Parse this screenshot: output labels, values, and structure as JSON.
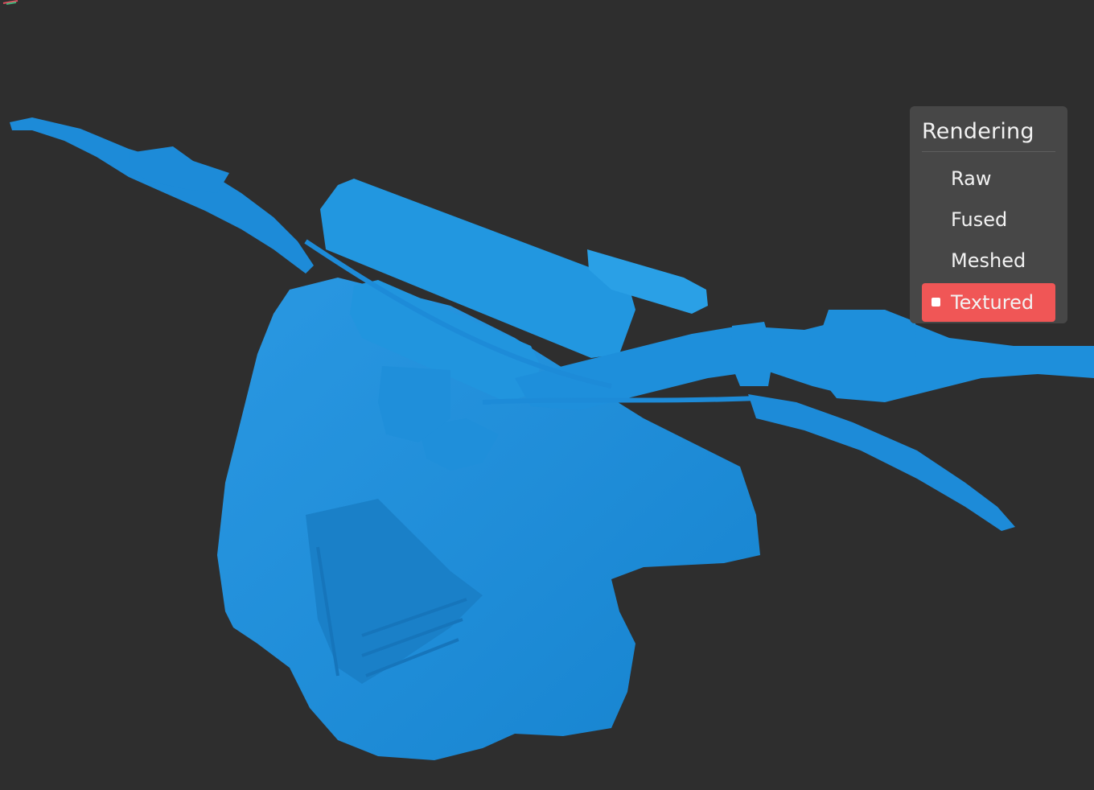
{
  "panel": {
    "title": "Rendering",
    "options": [
      {
        "label": "Raw",
        "selected": false
      },
      {
        "label": "Fused",
        "selected": false
      },
      {
        "label": "Meshed",
        "selected": false
      },
      {
        "label": "Textured",
        "selected": true
      }
    ],
    "accent_color": "#f05656"
  },
  "viewport": {
    "background_color": "#2e2e2e",
    "model_color": "#1c8ad6"
  }
}
